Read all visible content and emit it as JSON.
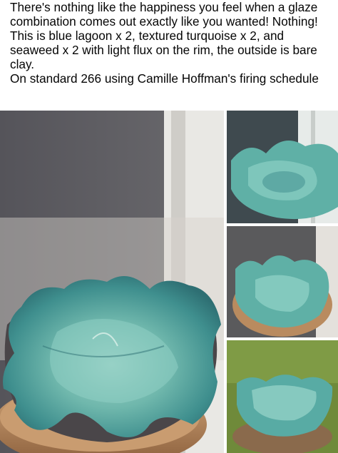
{
  "post": {
    "body_line_1": "There's nothing like the happiness you feel when a glaze combination comes out exactly like you wanted! Nothing! This is blue lagoon x 2, textured turquoise x 2, and seaweed x 2 with light flux on the rim, the outside is bare clay.",
    "body_line_2": "On standard 266 using Camille Hoffman's firing schedule"
  },
  "photos": [
    {
      "subject": "turquoise ruffled ceramic bowl on wooden stand"
    },
    {
      "subject": "bowl close-up by window"
    },
    {
      "subject": "bowl top view on wooden stump"
    },
    {
      "subject": "bowl outdoors on grass"
    }
  ],
  "colors": {
    "glaze": "#6fb7ac",
    "glaze_dark": "#2e6f73",
    "clay": "#6b615c",
    "wood": "#b98b5f"
  }
}
